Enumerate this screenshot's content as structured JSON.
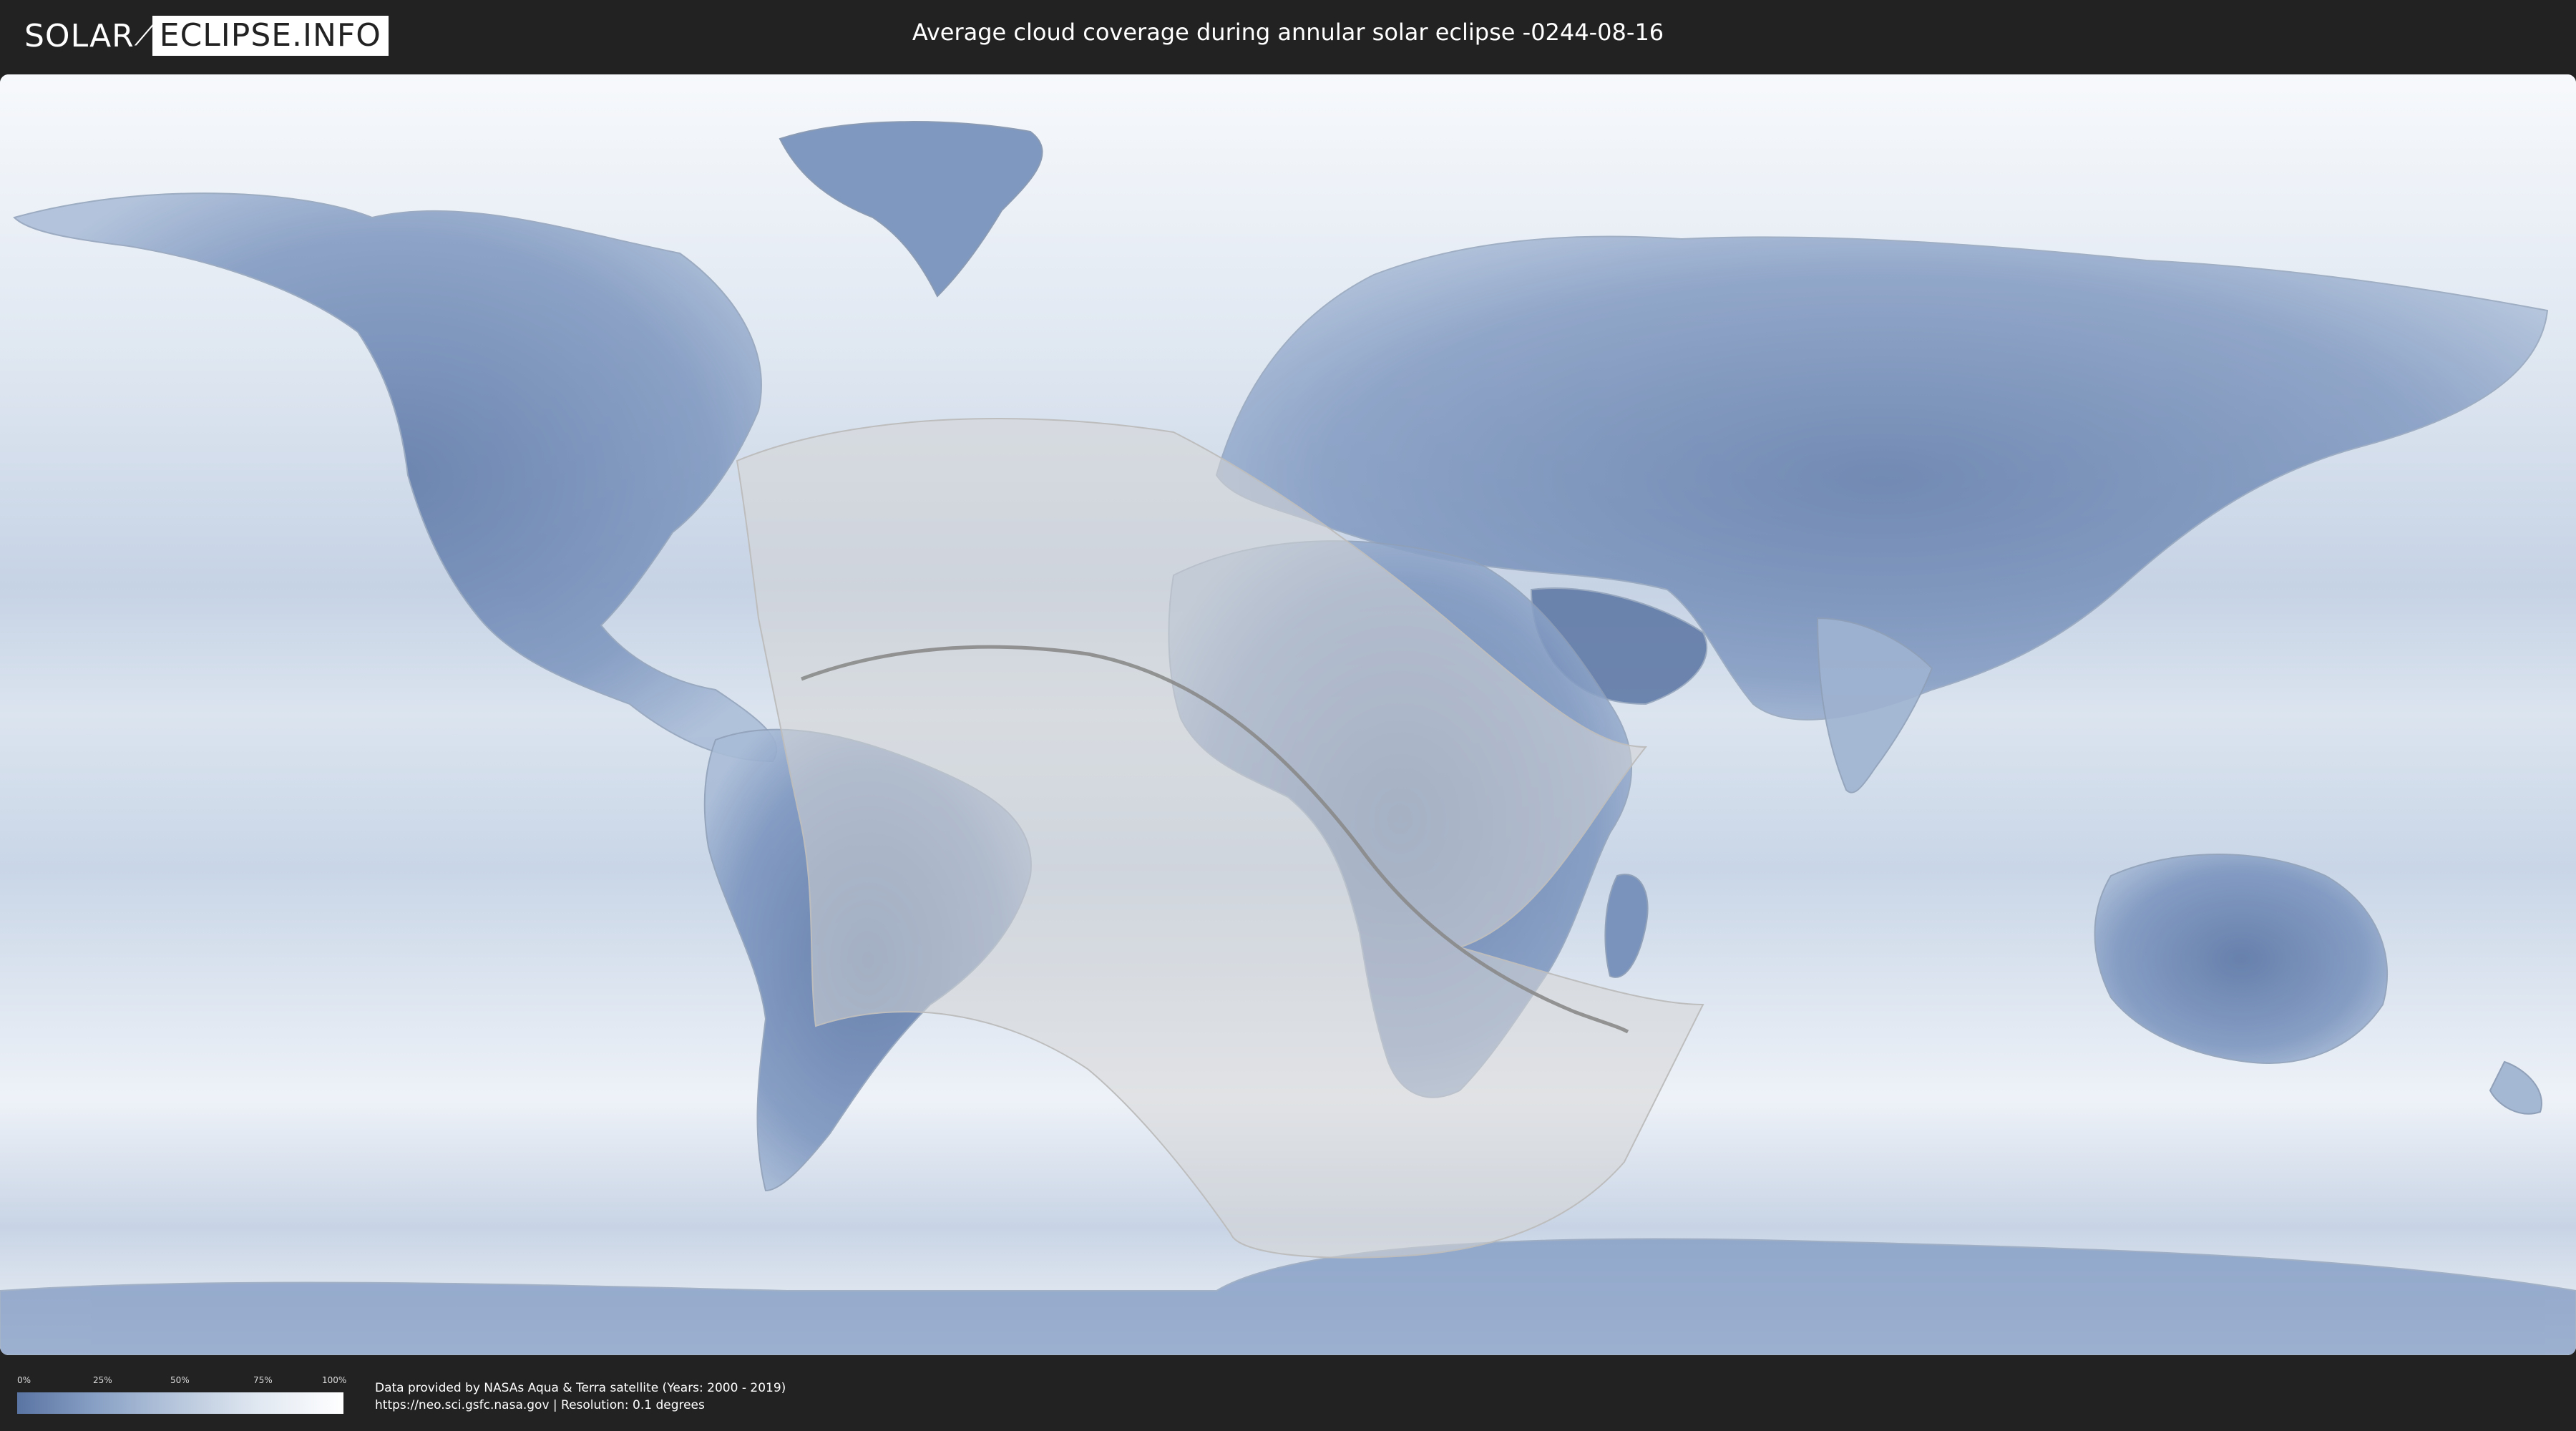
{
  "header": {
    "logo_part1": "SOLAR",
    "logo_part2": "ECLIPSE.INFO",
    "title": "Average cloud coverage during annular solar eclipse -0244-08-16"
  },
  "legend": {
    "ticks": [
      "0%",
      "25%",
      "50%",
      "75%",
      "100%"
    ],
    "colors": [
      "#5a74a3",
      "#8aa2c6",
      "#b9c8dd",
      "#e2e9f2",
      "#ffffff"
    ]
  },
  "footer": {
    "line1": "Data provided by NASAs Aqua & Terra satellite (Years: 2000 - 2019)",
    "line2": "https://neo.sci.gsfc.nasa.gov | Resolution: 0.1 degrees"
  },
  "map": {
    "ocean_color": "#eef3f9",
    "land_cloudfree_color": "#5f7ba8",
    "eclipse_overlay_color": "#d8d8d8"
  }
}
